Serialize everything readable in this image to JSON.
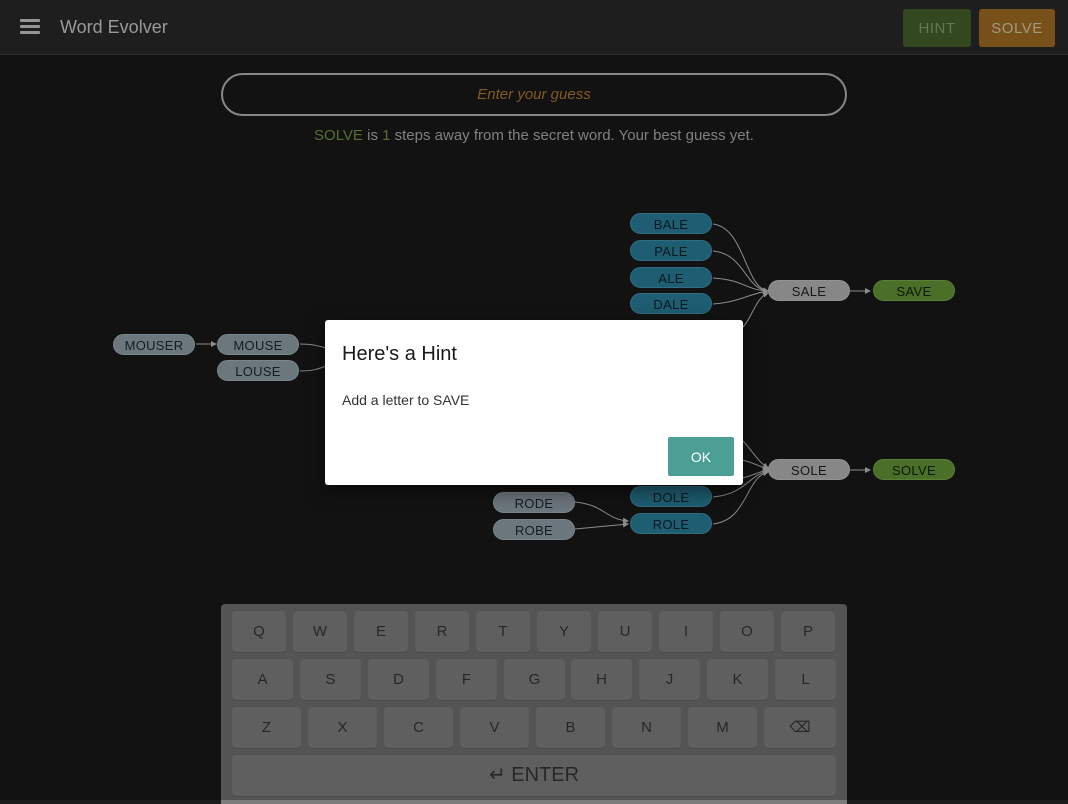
{
  "app": {
    "title": "Word Evolver"
  },
  "toolbar": {
    "hint_label": "HINT",
    "solve_label": "SOLVE",
    "hint_color": "#4d6a30",
    "solve_color": "#b07826"
  },
  "guess": {
    "placeholder": "Enter your guess"
  },
  "status": {
    "word": "SOLVE",
    "part1": " is ",
    "steps": "1",
    "part2": " steps away from the secret word. Your best guess yet."
  },
  "graph": {
    "nodes": {
      "bale": "BALE",
      "pale": "PALE",
      "ale": "ALE",
      "dale": "DALE",
      "sale": "SALE",
      "save": "SAVE",
      "mouser": "MOUSER",
      "mouse": "MOUSE",
      "louse": "LOUSE",
      "sole": "SOLE",
      "solve": "SOLVE",
      "dole": "DOLE",
      "role": "ROLE",
      "rode": "RODE",
      "robe": "ROBE"
    }
  },
  "dialog": {
    "title": "Here's a Hint",
    "message": "Add a letter to SAVE",
    "ok_label": "OK"
  },
  "keyboard": {
    "row1": [
      "Q",
      "W",
      "E",
      "R",
      "T",
      "Y",
      "U",
      "I",
      "O",
      "P"
    ],
    "row2": [
      "A",
      "S",
      "D",
      "F",
      "G",
      "H",
      "J",
      "K",
      "L"
    ],
    "row3": [
      "Z",
      "X",
      "C",
      "V",
      "B",
      "N",
      "M",
      "⌫"
    ],
    "enter_label": "ENTER",
    "enter_icon": "↵"
  }
}
